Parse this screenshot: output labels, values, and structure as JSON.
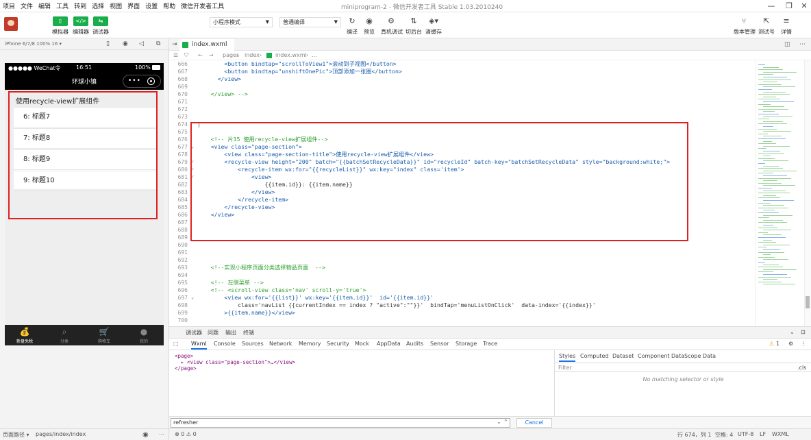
{
  "menu": [
    "项目",
    "文件",
    "编辑",
    "工具",
    "转到",
    "选择",
    "视图",
    "界面",
    "设置",
    "帮助",
    "微信开发者工具"
  ],
  "window_title": "miniprogram-2 - 微信开发者工具 Stable 1.03.2010240",
  "toolbar": {
    "sim": "模拟器",
    "editor": "编辑器",
    "debugger": "调试器",
    "mode": "小程序模式",
    "compile_mode": "普通编译",
    "compile": "编译",
    "preview": "预览",
    "remote_debug": "真机调试",
    "backstage": "切后台",
    "clear_cache": "清缓存",
    "version": "版本管理",
    "test": "测试号",
    "details": "详情"
  },
  "simulator": {
    "device": "iPhone 6/7/8 100% 16 ▾",
    "carrier": "●●●●● WeChat令",
    "time": "16:51",
    "battery": "100%",
    "nav_title": "环球小镇",
    "section_title": "使用recycle-view扩展组件",
    "items": [
      "6: 标题7",
      "7: 标题8",
      "8: 标题9",
      "9: 标题10"
    ],
    "tabs": [
      "新盘免税",
      "分类",
      "购物车",
      "我的"
    ],
    "footer_path_label": "页面路径 ▾",
    "footer_path": "pages/index/index"
  },
  "editor": {
    "file_tab": "index.wxml",
    "breadcrumb": [
      "pages",
      "index",
      "index.wxml",
      "..."
    ],
    "lines": [
      {
        "n": "666",
        "t": "        <button bindtap=\"scrollToView1\">滚动到子视图</button>"
      },
      {
        "n": "667",
        "t": "        <button bindtap=\"unshiftOnePic\">顶部添加一张图</button>"
      },
      {
        "n": "668",
        "t": "      </view>"
      },
      {
        "n": "669",
        "t": ""
      },
      {
        "n": "670",
        "t": "    </view> -->"
      },
      {
        "n": "671",
        "t": ""
      },
      {
        "n": "672",
        "t": ""
      },
      {
        "n": "673",
        "t": ""
      },
      {
        "n": "674",
        "t": "|"
      },
      {
        "n": "675",
        "t": ""
      },
      {
        "n": "676",
        "t": "    <!-- 片15 使用recycle-view扩展组件-->"
      },
      {
        "n": "677",
        "t": "    <view class=\"page-section\">"
      },
      {
        "n": "678",
        "t": "        <view class=\"page-section-title\">使用recycle-view扩展组件</view>"
      },
      {
        "n": "679",
        "t": "        <recycle-view height=\"200\" batch=\"{{batchSetRecycleData}}\" id=\"recycleId\" batch-key=\"batchSetRecycleData\" style=\"background:white;\">"
      },
      {
        "n": "680",
        "t": "            <recycle-item wx:for=\"{{recycleList}}\" wx:key=\"index\" class='item'>"
      },
      {
        "n": "681",
        "t": "                <view>"
      },
      {
        "n": "682",
        "t": "                    {{item.id}}: {{item.name}}"
      },
      {
        "n": "683",
        "t": "                </view>"
      },
      {
        "n": "684",
        "t": "            </recycle-item>"
      },
      {
        "n": "685",
        "t": "        </recycle-view>"
      },
      {
        "n": "686",
        "t": "    </view>"
      },
      {
        "n": "687",
        "t": ""
      },
      {
        "n": "688",
        "t": ""
      },
      {
        "n": "689",
        "t": ""
      },
      {
        "n": "690",
        "t": ""
      },
      {
        "n": "691",
        "t": ""
      },
      {
        "n": "692",
        "t": ""
      },
      {
        "n": "693",
        "t": "    <!--实现小程序页面分类选择物品页面  -->"
      },
      {
        "n": "694",
        "t": ""
      },
      {
        "n": "695",
        "t": "    <!-- 左侧菜单 -->"
      },
      {
        "n": "696",
        "t": "    <!-- <scroll-view class='nav' scroll-y='true'>"
      },
      {
        "n": "697",
        "t": "        <view wx:for='{{list}}' wx:key='{{item.id}}'  id='{{item.id}}'"
      },
      {
        "n": "698",
        "t": "            class='navList {{currentIndex == index ? \"active\":\"\"}}'  bindTap='menuListOnClick'  data-index='{{index}}'"
      },
      {
        "n": "699",
        "t": "        >{{item.name}}</view>"
      },
      {
        "n": "700",
        "t": ""
      }
    ]
  },
  "devtools": {
    "top_tabs": [
      "调试器",
      "问题",
      "输出",
      "终端"
    ],
    "panel_tabs": [
      "Wxml",
      "Console",
      "Sources",
      "Network",
      "Memory",
      "Security",
      "Mock",
      "AppData",
      "Audits",
      "Sensor",
      "Storage",
      "Trace"
    ],
    "tree": [
      "<page>",
      "  ▸ <view class=\"page-section\">…</view>",
      "</page>"
    ],
    "styles_tabs": [
      "Styles",
      "Computed",
      "Dataset",
      "Component Data",
      "Scope Data"
    ],
    "filter_placeholder": "Filter",
    "cls": ".cls",
    "no_match": "No matching selector or style",
    "warn_count": "1"
  },
  "find": {
    "value": "refresher",
    "cancel": "Cancel"
  },
  "status": {
    "errors": "⊗ 0 ⚠ 0",
    "position": "行 674，列 1",
    "spaces": "空格: 4",
    "encoding": "UTF-8",
    "eol": "LF",
    "lang": "WXML"
  }
}
